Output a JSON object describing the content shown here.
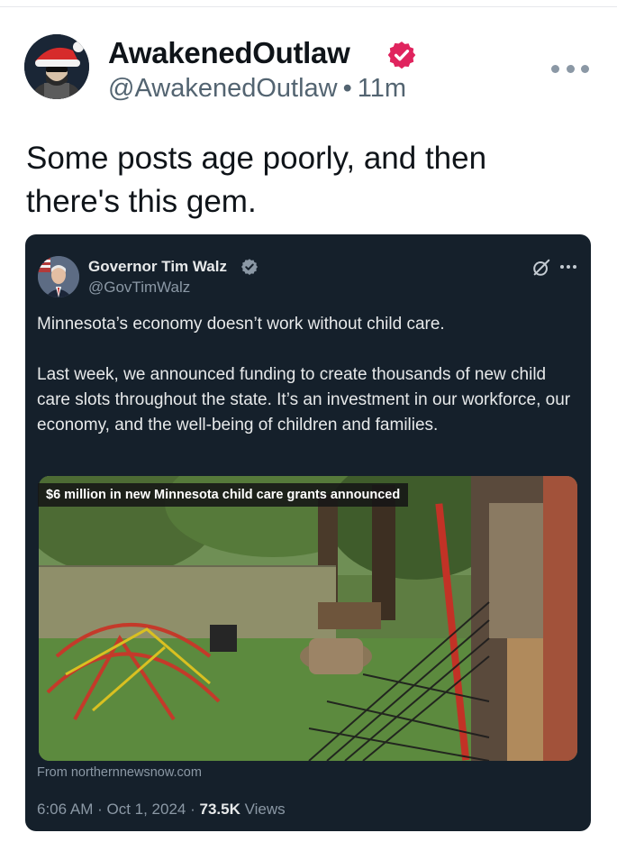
{
  "post": {
    "author_name": "AwakenedOutlaw",
    "handle": "@AwakenedOutlaw",
    "separator": "•",
    "time": "11m",
    "text": "Some posts age poorly, and then there's this gem."
  },
  "quoted_post": {
    "author_name": "Governor Tim Walz",
    "handle": "@GovTimWalz",
    "paragraphs": [
      "Minnesota’s economy doesn’t work without child care.",
      "Last week, we announced funding to create thousands of new child care slots throughout the state. It’s an investment in our workforce, our economy, and the well-being of children and families."
    ],
    "media_caption": "$6 million in new Minnesota child care grants announced",
    "source": "From northernnewsnow.com",
    "timestamp": "6:06 AM · Oct 1, 2024 · ",
    "views_count": "73.5K",
    "views_label": " Views"
  },
  "colors": {
    "verified_badge": "#e0245e",
    "quote_background": "#15202b",
    "secondary_text": "#536471"
  },
  "icons": {
    "verified": "verified-badge-icon",
    "more": "more-horizontal-icon",
    "grok": "grok-icon"
  }
}
